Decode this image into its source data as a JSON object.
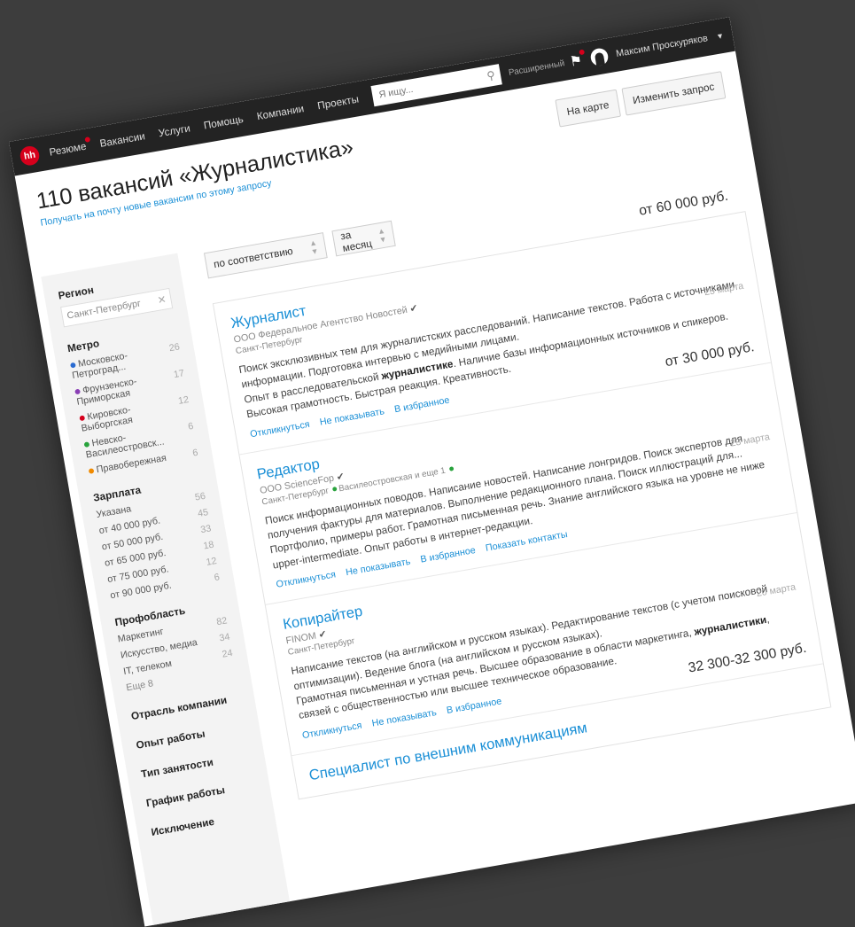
{
  "topbar": {
    "logo": "hh",
    "nav": [
      "Резюме",
      "Вакансии",
      "Услуги",
      "Помощь",
      "Компании",
      "Проекты"
    ],
    "search_placeholder": "Я ищу...",
    "advanced": "Расширенный",
    "user_name": "Максим Проскуряков"
  },
  "header": {
    "title": "110 вакансий «Журналистика»",
    "subscribe": "Получать на почту новые вакансии по этому запросу",
    "map_button": "На карте",
    "change_button": "Изменить запрос"
  },
  "sort": {
    "order": "по соответствию",
    "period": "за месяц"
  },
  "sidebar": {
    "region_title": "Регион",
    "region_value": "Санкт-Петербург",
    "metro_title": "Метро",
    "metro": [
      {
        "label": "Московско-Петроград...",
        "count": "26",
        "color": "#2a6bd1"
      },
      {
        "label": "Фрунзенско-Приморская",
        "count": "17",
        "color": "#8a3fb5"
      },
      {
        "label": "Кировско-Выборгская",
        "count": "12",
        "color": "#d6001c"
      },
      {
        "label": "Невско-Василеостровск...",
        "count": "6",
        "color": "#29a33d"
      },
      {
        "label": "Правобережная",
        "count": "6",
        "color": "#f08a00"
      }
    ],
    "salary_title": "Зарплата",
    "salary": [
      {
        "label": "Указана",
        "count": "56"
      },
      {
        "label": "от 40 000 руб.",
        "count": "45"
      },
      {
        "label": "от 50 000 руб.",
        "count": "33"
      },
      {
        "label": "от 65 000 руб.",
        "count": "18"
      },
      {
        "label": "от 75 000 руб.",
        "count": "12"
      },
      {
        "label": "от 90 000 руб.",
        "count": "6"
      }
    ],
    "prof_title": "Профобласть",
    "prof": [
      {
        "label": "Маркетинг",
        "count": "82"
      },
      {
        "label": "Искусство, медиа",
        "count": "34"
      },
      {
        "label": "IT, телеком",
        "count": "24"
      }
    ],
    "more": "Еще 8",
    "sections": [
      "Отрасль компании",
      "Опыт работы",
      "Тип занятости",
      "График работы",
      "Исключение"
    ]
  },
  "vacancies": [
    {
      "salary": "от 60 000 руб.",
      "title": "Журналист",
      "company": "ООО Федеральное Агентство Новостей",
      "location": "Санкт-Петербург",
      "metro": "",
      "responsibility": "Поиск эксклюзивных тем для журналистских расследований. Написание текстов. Работа с источниками информации. Подготовка интервью с медийными лицами.",
      "req_before": "Опыт в расследовательской ",
      "req_bold": "журналистике",
      "req_after": ". Наличие базы информационных источников и спикеров. Высокая грамотность. Быстрая реакция. Креативность.",
      "date": "25 марта",
      "actions": [
        "Откликнуться",
        "Не показывать",
        "В избранное"
      ]
    },
    {
      "salary": "от 30 000 руб.",
      "title": "Редактор",
      "company": "ООО ScienceFор",
      "location": "Санкт-Петербург",
      "metro": "Василеостровская и еще 1",
      "responsibility": "Поиск информационных поводов. Написание новостей. Написание лонгридов. Поиск экспертов для получения фактуры для материалов. Выполнение редакционного плана. Поиск иллюстраций для...",
      "req_before": "Портфолио, примеры работ. Грамотная письменная речь. Знание английского языка на уровне не ниже upper-intermediate. Опыт работы в интернет-редакции.",
      "req_bold": "",
      "req_after": "",
      "date": "23 марта",
      "actions": [
        "Откликнуться",
        "Не показывать",
        "В избранное",
        "Показать контакты"
      ]
    },
    {
      "salary": "",
      "title": "Копирайтер",
      "company": "FINOM",
      "location": "Санкт-Петербург",
      "metro": "",
      "responsibility": "Написание текстов (на английском и русском языках). Редактирование текстов (с учетом поисковой оптимизации). Ведение блога (на английском и русском языках).",
      "req_before": "Грамотная письменная и устная речь. Высшее образование в области маркетинга, ",
      "req_bold": "журналистики",
      "req_after": ", связей с общественностью или высшее техническое образование.",
      "date": "20 марта",
      "actions": [
        "Откликнуться",
        "Не показывать",
        "В избранное"
      ]
    },
    {
      "salary": "32 300-32 300 руб.",
      "title": "Специалист по внешним коммуникациям",
      "company": "",
      "location": "",
      "metro": "",
      "responsibility": "",
      "req_before": "",
      "req_bold": "",
      "req_after": "",
      "date": "",
      "actions": []
    }
  ]
}
